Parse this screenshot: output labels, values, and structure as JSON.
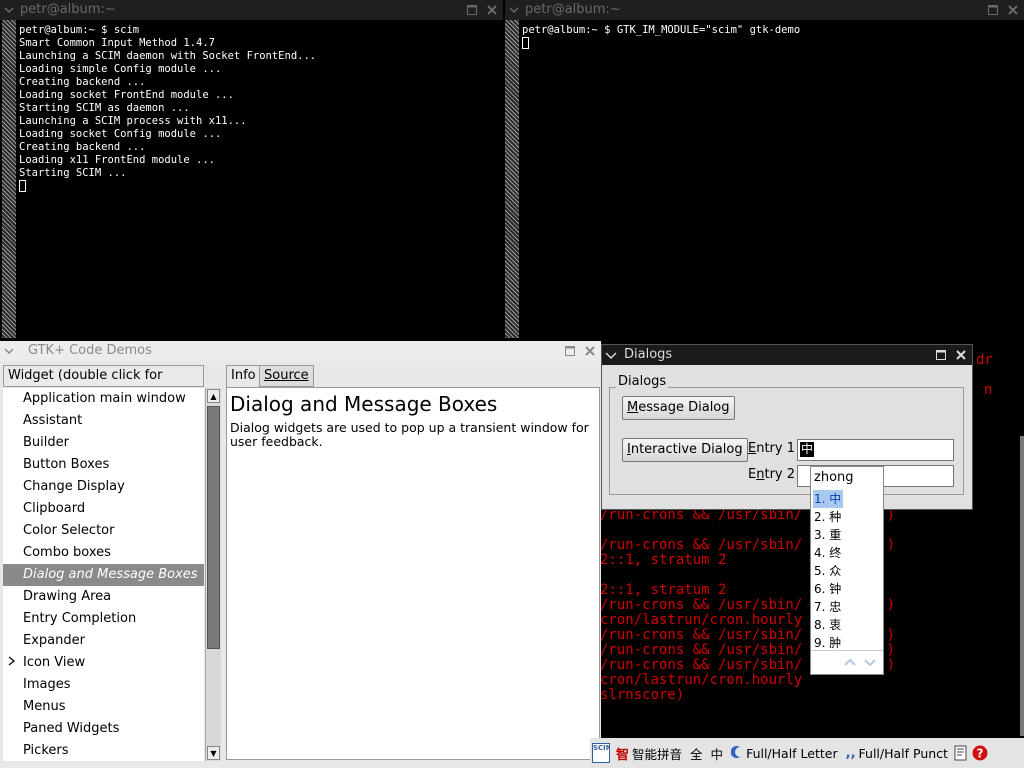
{
  "term1": {
    "title": "petr@album:~",
    "lines": [
      "petr@album:~ $ scim",
      "Smart Common Input Method 1.4.7",
      "",
      "Launching a SCIM daemon with Socket FrontEnd...",
      "Loading simple Config module ...",
      "Creating backend ...",
      "Loading socket FrontEnd module ...",
      "Starting SCIM as daemon ...",
      "Launching a SCIM process with x11...",
      "Loading socket Config module ...",
      "Creating backend ...",
      "Loading x11 FrontEnd module ...",
      "Starting SCIM ..."
    ]
  },
  "term2": {
    "title": "petr@album:~",
    "lines": [
      "petr@album:~ $ GTK_IM_MODULE=\"scim\" gtk-demo"
    ]
  },
  "red_term": {
    "right_fragments": [
      "dr",
      "n"
    ],
    "lines": [
      "/run-crons && /usr/sbin/        s )",
      "",
      "/run-crons && /usr/sbin/        s )",
      "2::1, stratum 2",
      "",
      "2::1, stratum 2",
      "/run-crons && /usr/sbin/        s )",
      "cron/lastrun/cron.hourly",
      "/run-crons && /usr/sbin/        s )",
      "/run-crons && /usr/sbin/        s )",
      "/run-crons && /usr/sbin/        s )",
      "cron/lastrun/cron.hourly",
      "slrnscore)"
    ]
  },
  "gtk_demo": {
    "title": "GTK+ Code Demos",
    "tree_header": "Widget (double click for demo)",
    "items": [
      {
        "label": "Application main window",
        "expander": false
      },
      {
        "label": "Assistant",
        "expander": false
      },
      {
        "label": "Builder",
        "expander": false
      },
      {
        "label": "Button Boxes",
        "expander": false
      },
      {
        "label": "Change Display",
        "expander": false
      },
      {
        "label": "Clipboard",
        "expander": false
      },
      {
        "label": "Color Selector",
        "expander": false
      },
      {
        "label": "Combo boxes",
        "expander": false
      },
      {
        "label": "Dialog and Message Boxes",
        "expander": false
      },
      {
        "label": "Drawing Area",
        "expander": false
      },
      {
        "label": "Entry Completion",
        "expander": false
      },
      {
        "label": "Expander",
        "expander": false
      },
      {
        "label": "Icon View",
        "expander": true
      },
      {
        "label": "Images",
        "expander": false
      },
      {
        "label": "Menus",
        "expander": false
      },
      {
        "label": "Paned Widgets",
        "expander": false
      },
      {
        "label": "Pickers",
        "expander": false
      }
    ],
    "selected_index": 8,
    "tabs": [
      "Info",
      "Source"
    ],
    "info_title": "Dialog and Message Boxes",
    "info_desc": "Dialog widgets are used to pop up a transient window for user feedback."
  },
  "dialogs": {
    "title": "Dialogs",
    "frame_label": "Dialogs",
    "message_dialog_btn": {
      "before": "",
      "ul": "M",
      "after": "essage Dialog"
    },
    "interactive_dialog_btn": {
      "before": "",
      "ul": "I",
      "after": "nteractive Dialog"
    },
    "entry1_label": {
      "before": "",
      "ul": "E",
      "after": "ntry 1"
    },
    "entry2_label": {
      "before": "E",
      "ul": "n",
      "after": "try 2"
    },
    "entry1_value": "中"
  },
  "candidates": {
    "preedit": "zhong",
    "items": [
      "1. 中",
      "2. 种",
      "3. 重",
      "4. 终",
      "5. 众",
      "6. 钟",
      "7. 忠",
      "8. 衷",
      "9. 肿"
    ],
    "selected": 0
  },
  "scim_bar": {
    "logo": "SCIM",
    "im_icon": "智",
    "im_name": "智能拼音",
    "full_char": "全",
    "chinese_char": "中",
    "letter_mode": "Full/Half Letter",
    "punct_mode": "Full/Half Punct",
    "colors": {
      "im_red": "#c00000",
      "help": "#d01010"
    }
  },
  "colors": {
    "terminal_red": "#d00000",
    "selection_gray": "#8a8a8a"
  }
}
